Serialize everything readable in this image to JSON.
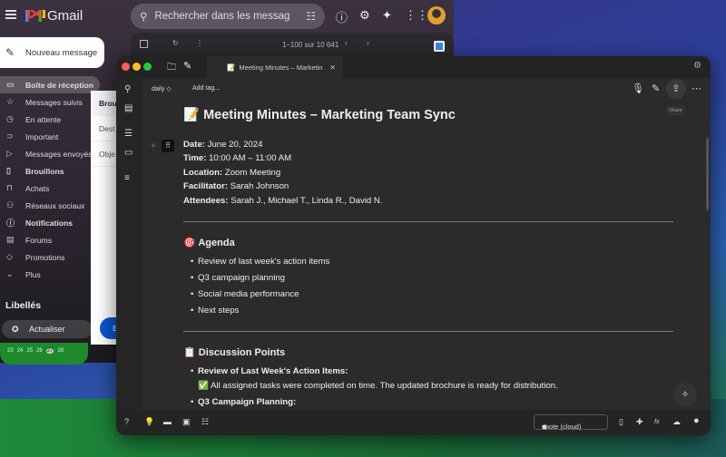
{
  "gmail": {
    "app_name": "Gmail",
    "search_placeholder": "Rechercher dans les messag",
    "compose_label": "Nouveau message",
    "pagination": "1–100 sur 10 641",
    "nav": [
      {
        "label": "Boîte de réception",
        "icon": "inbox-icon"
      },
      {
        "label": "Messages suivis",
        "icon": "star-icon"
      },
      {
        "label": "En attente",
        "icon": "clock-icon"
      },
      {
        "label": "Important",
        "icon": "important-icon"
      },
      {
        "label": "Messages envoyés",
        "icon": "send-icon"
      },
      {
        "label": "Brouillons",
        "icon": "draft-icon"
      },
      {
        "label": "Achats",
        "icon": "shopping-icon"
      },
      {
        "label": "Réseaux sociaux",
        "icon": "social-icon"
      },
      {
        "label": "Notifications",
        "icon": "info-icon"
      },
      {
        "label": "Forums",
        "icon": "forum-icon"
      },
      {
        "label": "Promotions",
        "icon": "tag-icon"
      },
      {
        "label": "Plus",
        "icon": "chevron-down-icon"
      }
    ],
    "labels_title": "Libellés",
    "refresh_label": "Actualiser",
    "calendar_days": [
      "23",
      "24",
      "25",
      "26",
      "27",
      "28"
    ],
    "draft": {
      "header": "Brou",
      "to": "Dest",
      "subject": "Obje",
      "send": "En"
    }
  },
  "znote": {
    "tab_title": "Meeting Minutes – Marketin",
    "folder": "daily ◇",
    "add_tag": "Add tag...",
    "share_tooltip": "Share",
    "doc": {
      "title": "📝 Meeting Minutes – Marketing Team Sync",
      "meta": [
        {
          "k": "Date:",
          "v": " June 20, 2024"
        },
        {
          "k": "Time:",
          "v": " 10:00 AM – 11:00 AM"
        },
        {
          "k": "Location:",
          "v": " Zoom Meeting"
        },
        {
          "k": "Facilitator:",
          "v": " Sarah Johnson"
        },
        {
          "k": "Attendees:",
          "v": " Sarah J., Michael T., Linda R., David N."
        }
      ],
      "agenda_title": "🎯 Agenda",
      "agenda": [
        "Review of last week's action items",
        "Q3 campaign planning",
        "Social media performance",
        "Next steps"
      ],
      "discussion_title": "📋 Discussion Points",
      "discussion": [
        {
          "title": "Review of Last Week's Action Items:",
          "text": "✅ All assigned tasks were completed on time. The updated brochure is ready for distribution."
        },
        {
          "title": "Q3 Campaign Planning:"
        }
      ]
    },
    "workspace": "znote (cloud)"
  }
}
